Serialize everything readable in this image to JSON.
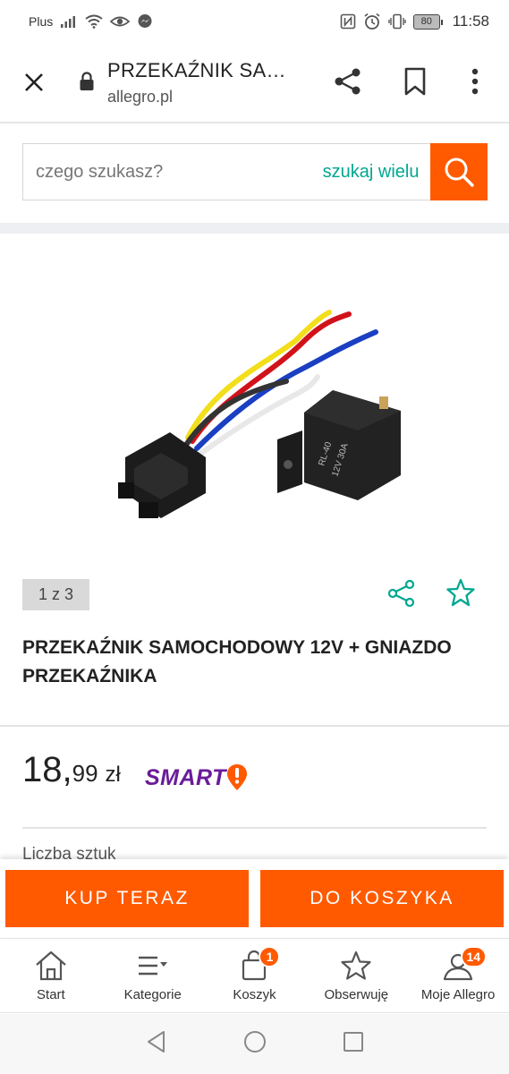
{
  "status_bar": {
    "carrier": "Plus",
    "battery": "80",
    "time": "11:58"
  },
  "browser": {
    "title": "PRZEKAŹNIK SA…",
    "url": "allegro.pl"
  },
  "search": {
    "placeholder": "czego szukasz?",
    "many_label": "szukaj wielu"
  },
  "product": {
    "gallery_counter": "1 z 3",
    "title": "PRZEKAŹNIK SAMOCHODOWY 12V + GNIAZDO PRZEKAŹNIKA",
    "relay_marking_1": "RL-40",
    "relay_marking_2": "12V 30A",
    "price_main": "18,",
    "price_cents": "99",
    "currency": "zł",
    "smart_label": "SMART",
    "quantity_label": "Liczba sztuk"
  },
  "actions": {
    "buy_now": "KUP TERAZ",
    "add_to_cart": "DO KOSZYKA"
  },
  "bottom_nav": {
    "items": [
      {
        "label": "Start",
        "icon": "home-icon"
      },
      {
        "label": "Kategorie",
        "icon": "menu-icon"
      },
      {
        "label": "Koszyk",
        "icon": "cart-icon",
        "badge": "1"
      },
      {
        "label": "Obserwuję",
        "icon": "star-icon"
      },
      {
        "label": "Moje Allegro",
        "icon": "user-icon",
        "badge": "14"
      }
    ]
  },
  "colors": {
    "accent": "#ff5a00",
    "teal": "#00a790",
    "smart_purple": "#6a1b9a"
  }
}
